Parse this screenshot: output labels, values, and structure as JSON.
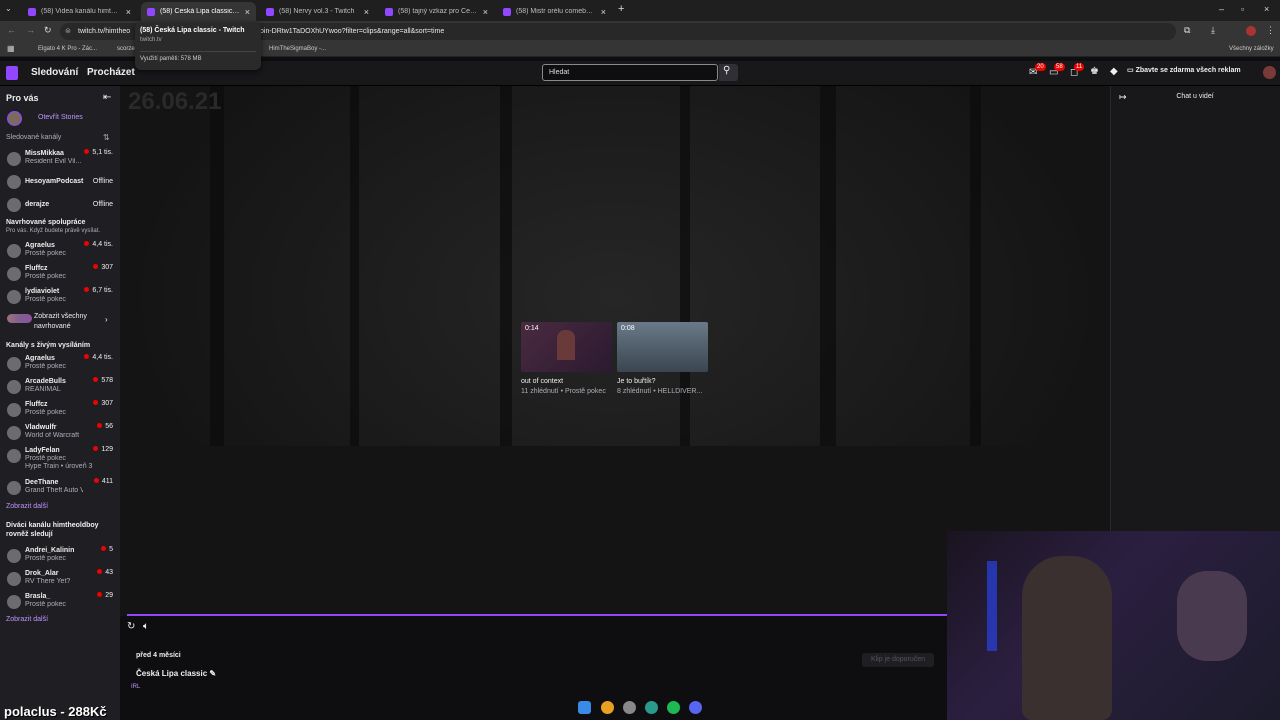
{
  "browser": {
    "tabs": [
      {
        "title": "(58) Videa kanálu himtheoldbo",
        "active": false
      },
      {
        "title": "(58) Česká Lipa classic - Twitch",
        "active": true
      },
      {
        "title": "(58) Nervy vol.3 - Twitch",
        "active": false
      },
      {
        "title": "(58) tajný vzkaz pro Čekyho - T",
        "active": false
      },
      {
        "title": "(58) Mistr orélu comeback - Tw",
        "active": false
      }
    ],
    "new_tab": "+",
    "url_left": "twitch.tv/himtheo",
    "url_right": "oin-DRtw1TaDOXhUYwoo?filter=clips&range=all&sort=time",
    "bookmarks": [
      "Elgato 4 K Pro - Zác...",
      "scorze",
      "HimTheSigmaBoy -..."
    ],
    "all_bookmarks": "Všechny záložky",
    "hovercard": {
      "title": "(58) Česká Lipa classic - Twitch",
      "domain": "twitch.tv",
      "memory": "Využití paměti: 578 MB"
    }
  },
  "twitch_nav": {
    "following": "Sledování",
    "browse": "Procházet",
    "search_placeholder": "Hledat",
    "badges": [
      "20",
      "58",
      "11"
    ],
    "ads": "Zbavte se zdarma všech reklam"
  },
  "sidebar": {
    "for_you": "Pro vás",
    "open_stories": "Otevřít Stories",
    "followed_channels": "Sledované kanály",
    "followed": [
      {
        "name": "MissMikkaa",
        "game": "Resident Evil Vil...",
        "viewers": "5,1 tis.",
        "live": true
      },
      {
        "name": "HesoyamPodcast",
        "game": "",
        "viewers": "Offline",
        "live": false
      },
      {
        "name": "derajze",
        "game": "",
        "viewers": "Offline",
        "live": false
      }
    ],
    "recommended_head": "Navrhované spolupráce",
    "recommended_note": "Pro vás. Když budete právě vysílat.",
    "recommended": [
      {
        "name": "Agraelus",
        "game": "Prostě pokec",
        "viewers": "4,4 tis.",
        "live": true
      },
      {
        "name": "Fluffcz",
        "game": "Prostě pokec",
        "viewers": "307",
        "live": true
      },
      {
        "name": "lydiaviolet",
        "game": "Prostě pokec",
        "viewers": "6,7 tis.",
        "live": true
      }
    ],
    "show_all_line1": "Zobrazit všechny",
    "show_all_line2": "navrhované",
    "live_head": "Kanály s živým vysíláním",
    "live": [
      {
        "name": "Agraelus",
        "game": "Prostě pokec",
        "viewers": "4,4 tis.",
        "live": true
      },
      {
        "name": "ArcadeBulls",
        "game": "REANIMAL",
        "viewers": "578",
        "live": true
      },
      {
        "name": "Fluffcz",
        "game": "Prostě pokec",
        "viewers": "307",
        "live": true
      },
      {
        "name": "Vladwulfr",
        "game": "World of Warcraft",
        "viewers": "56",
        "live": true
      },
      {
        "name": "LadyFelan",
        "game": "Prostě pokec",
        "viewers": "129",
        "live": true,
        "extra": "Hype Train • úroveň 3"
      },
      {
        "name": "DeeThane",
        "game": "Grand Theft Auto V",
        "viewers": "411",
        "live": true
      }
    ],
    "show_more": "Zobrazit další",
    "viewers_head_line1": "Diváci kanálu himtheoldboy",
    "viewers_head_line2": "rovněž sledují",
    "viewers_also": [
      {
        "name": "Andrei_Kalinin",
        "game": "Prostě pokec",
        "viewers": "5",
        "live": true
      },
      {
        "name": "Drok_Alar",
        "game": "RV There Yet?",
        "viewers": "43",
        "live": true
      },
      {
        "name": "Brasla_",
        "game": "Prostě pokec",
        "viewers": "29",
        "live": true
      }
    ],
    "show_more2": "Zobrazit další"
  },
  "player": {
    "overlay_date": "26.06.21",
    "clips": [
      {
        "duration": "0:14",
        "title": "out of context",
        "meta": "11 zhlédnutí • Prostě pokec"
      },
      {
        "duration": "0:08",
        "title": "Je to buřtík?",
        "meta": "8 zhlédnutí • HELLDIVER..."
      }
    ]
  },
  "clip_info": {
    "ago": "před 4 měsíci",
    "title": "Česká Lipa classic",
    "category": "IRL",
    "recommend": "Klip je doporučen"
  },
  "chat": {
    "title": "Chat u videí"
  },
  "stream_overlay": {
    "name": "polaclus - 288Kč"
  },
  "colors": {
    "accent": "#9146ff",
    "live": "#eb0400",
    "link": "#bf94ff"
  }
}
